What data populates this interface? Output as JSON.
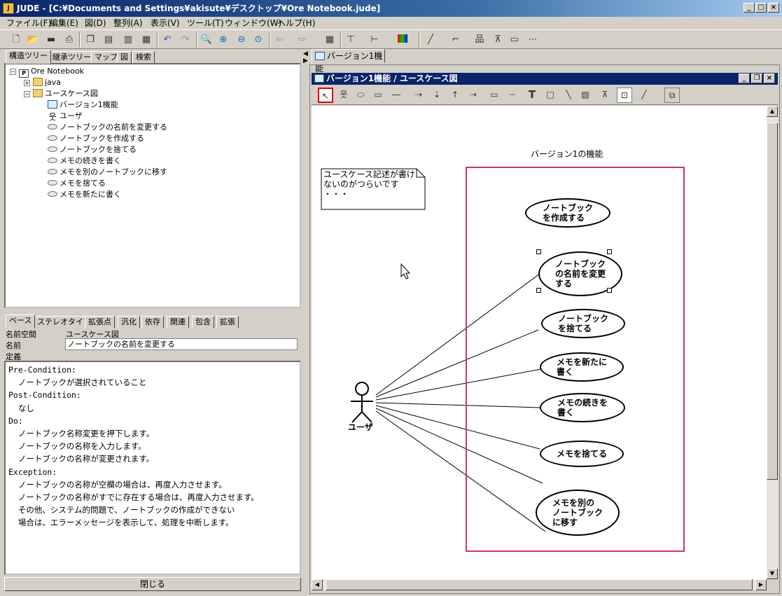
{
  "window": {
    "app_icon": "JUDE-logo",
    "title": "JUDE - [C:¥Documents and Settings¥akisute¥デスクトップ¥Ore Notebook.jude]",
    "minimize": "_",
    "maximize": "□",
    "close": "×"
  },
  "menubar": [
    "ファイル(F)",
    "編集(E)",
    "図(D)",
    "整列(A)",
    "表示(V)",
    "ツール(T)",
    "ウィンドウ(W)",
    "ヘルプ(H)"
  ],
  "toolbar_icons": [
    "new-file-icon",
    "open-folder-icon",
    "save-icon",
    "print-icon",
    "copy-icon",
    "paste-icon",
    "copy-diagram-icon",
    "paste-diagram-icon",
    "undo-icon",
    "redo-icon",
    "zoom-fit-icon",
    "zoom-in-icon",
    "zoom-out-icon",
    "zoom-reset-icon",
    "back-icon",
    "forward-icon",
    "grid-icon",
    "align-top-icon",
    "align-left-icon",
    "color-icon",
    "line-icon",
    "line-style-icon",
    "tree-layout-icon",
    "hierarchy-icon",
    "shape-icon",
    "more-icon"
  ],
  "left_tabs": [
    "構造ツリー",
    "継承ツリー",
    "マップ",
    "図",
    "検索"
  ],
  "tree": {
    "root": "Ore Notebook",
    "folders": [
      "java",
      "ユースケース図"
    ],
    "diagram": "バージョン1機能",
    "actor": "ユーザ",
    "usecases": [
      "ノートブックの名前を変更する",
      "ノートブックを作成する",
      "ノートブックを捨てる",
      "メモの続きを書く",
      "メモを別のノートブックに移す",
      "メモを捨てる",
      "メモを新たに書く"
    ]
  },
  "prop_tabs": [
    "ベース",
    "ステレオタイプ",
    "拡張点",
    "汎化",
    "依存",
    "関連",
    "包含",
    "拡張"
  ],
  "props": {
    "namespace_label": "名前空間",
    "namespace_value": "ユースケース図",
    "name_label": "名前",
    "name_value": "ノートブックの名前を変更する",
    "definition_label": "定義"
  },
  "definition_lines": [
    "Pre-Condition:",
    "  ノートブックが選択されていること",
    "Post-Condition:",
    "  なし",
    "Do:",
    "  ノートブック名称変更を押下します。",
    "  ノートブックの名称を入力します。",
    "  ノートブックの名称が変更されます。",
    "Exception:",
    "  ノートブックの名称が空欄の場合は、再度入力させます。",
    "  ノートブックの名称がすでに存在する場合は、再度入力させます。",
    "  その他、システム的問題で、ノートブックの作成ができない",
    "  場合は、エラーメッセージを表示して、処理を中断します。"
  ],
  "close_button": "閉じる",
  "doc_tab": "バージョン1機能",
  "inner_window": {
    "title": "バージョン1機能 / ユースケース図",
    "minimize": "_",
    "restore": "❐",
    "close": "×"
  },
  "diagram_tools": [
    "select-icon",
    "actor-tool-icon",
    "usecase-tool-icon",
    "system-boundary-icon",
    "association-icon",
    "extend-icon",
    "include-icon",
    "generalization-icon",
    "dependency-icon",
    "note-icon",
    "note-anchor-icon",
    "text-tool-icon",
    "rectangle-icon",
    "line-tool-icon",
    "image-icon",
    "pin-icon",
    "snap-icon",
    "line-style-icon",
    "layer-icon"
  ],
  "diagram": {
    "boundary_title": "バージョン1の機能",
    "note_lines": [
      "ユースケース記述が書け",
      "ないのがつらいです",
      "・・・"
    ],
    "actor_name": "ユーザ",
    "usecases": [
      {
        "label": "ノートブック\nを作成する",
        "selected": false
      },
      {
        "label": "ノートブック\nの名前を変更\nする",
        "selected": true
      },
      {
        "label": "ノートブック\nを捨てる",
        "selected": false
      },
      {
        "label": "メモを新たに\n書く",
        "selected": false
      },
      {
        "label": "メモの続きを\n書く",
        "selected": false
      },
      {
        "label": "メモを捨てる",
        "selected": false
      },
      {
        "label": "メモを別の\nノートブック\nに移す",
        "selected": false
      }
    ]
  },
  "colors": {
    "titlebar": "#0a246a",
    "boundary": "#cc3366",
    "selected_tool": "#e00000"
  }
}
